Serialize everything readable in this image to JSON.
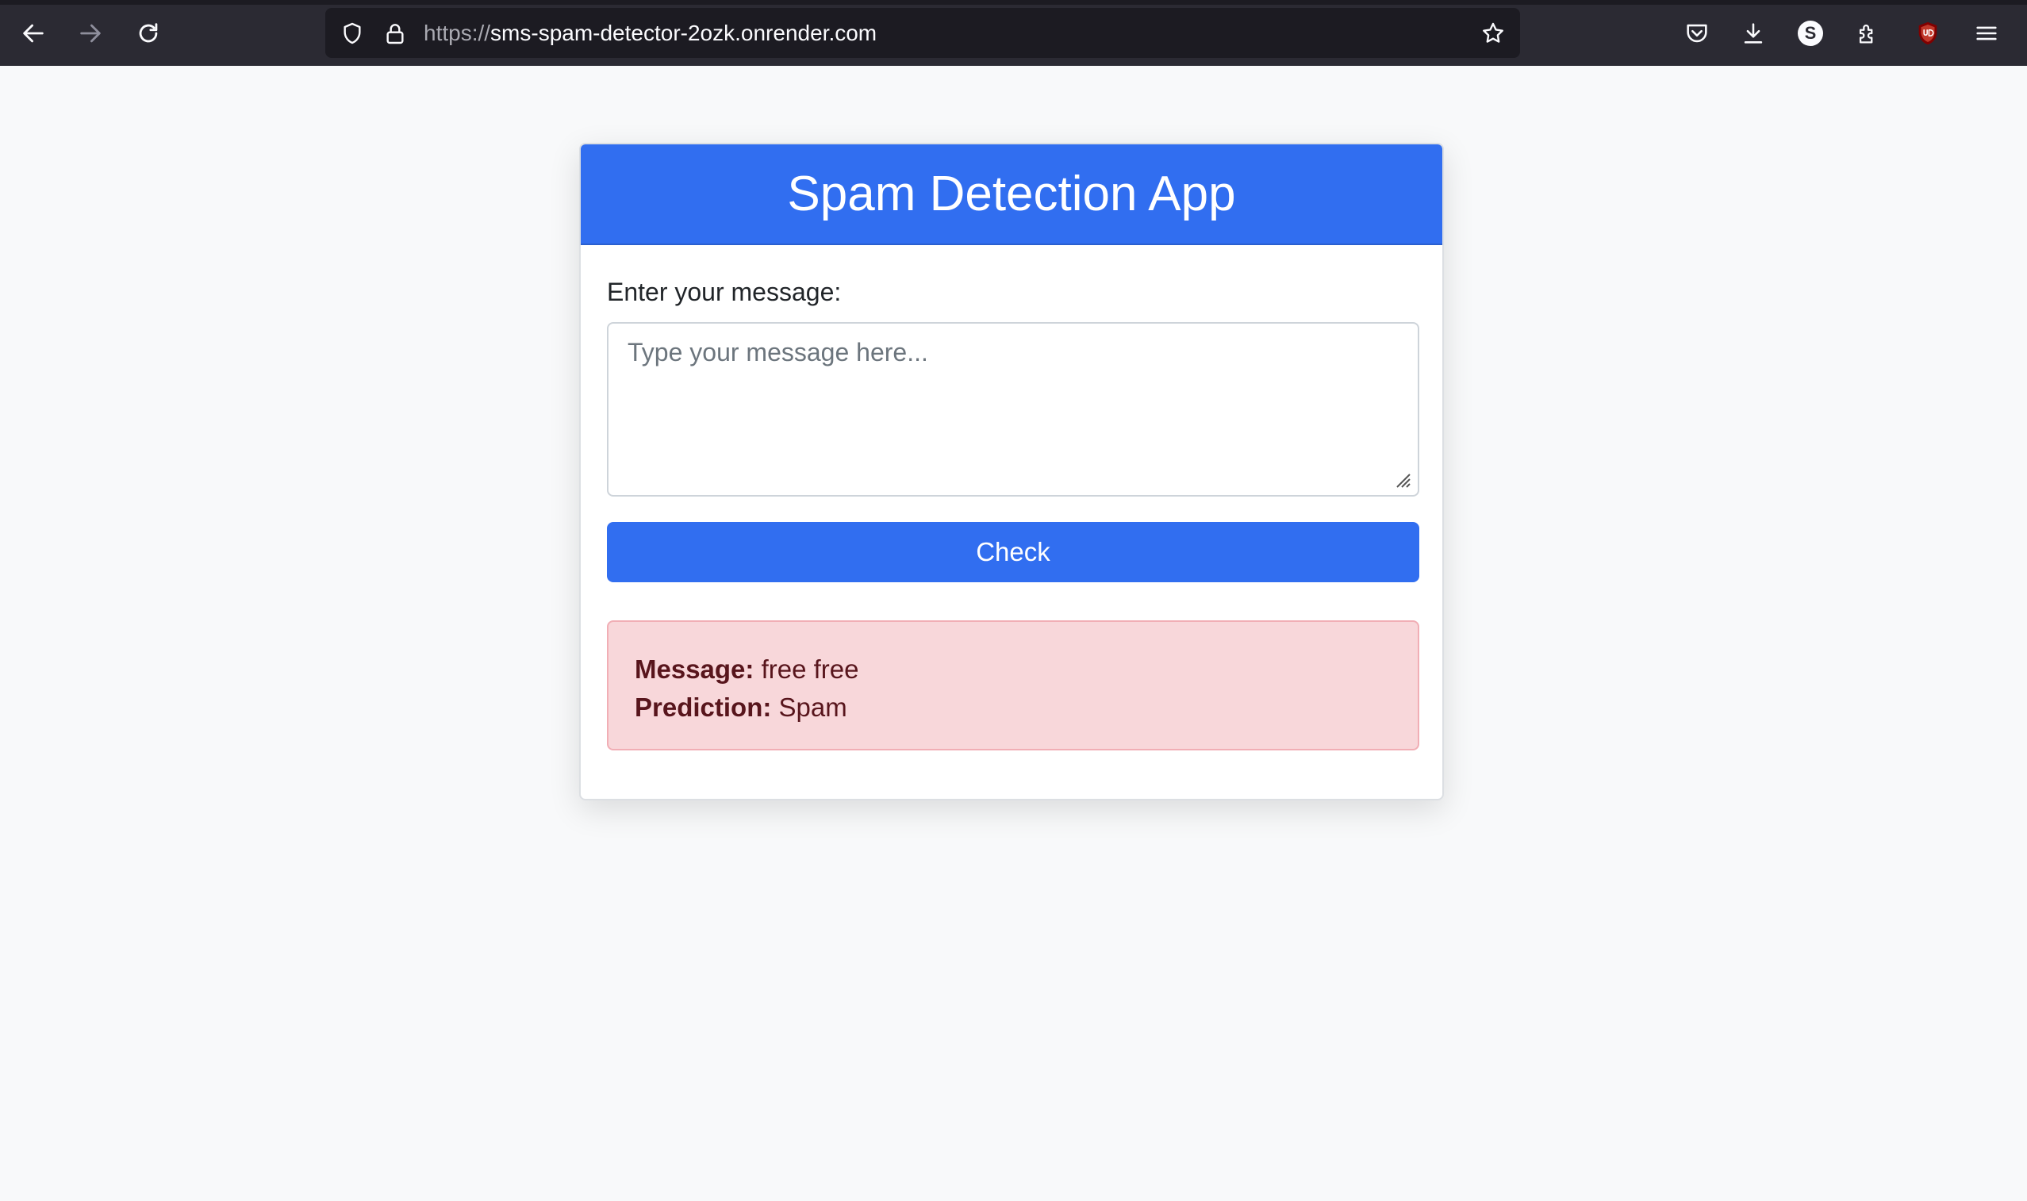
{
  "browser": {
    "url_scheme": "https://",
    "url_host": "sms-spam-detector-2ozk.onrender.com",
    "profile_initial": "S"
  },
  "page": {
    "title": "Spam Detection App",
    "input_label": "Enter your message:",
    "textarea_placeholder": "Type your message here...",
    "check_button": "Check",
    "result": {
      "message_label": "Message:",
      "message_value": "free free",
      "prediction_label": "Prediction:",
      "prediction_value": "Spam"
    }
  },
  "colors": {
    "accent": "#316ef0",
    "alert_background": "#f8d7da",
    "alert_text": "#58151c",
    "chrome": "#2b2a33"
  }
}
